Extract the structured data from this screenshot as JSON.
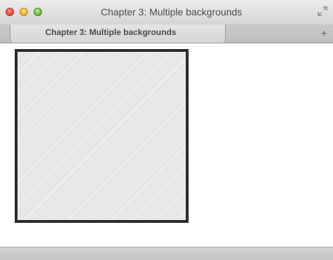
{
  "window": {
    "title": "Chapter 3: Multiple backgrounds",
    "controls": [
      "close-button",
      "minimize-button",
      "zoom-button"
    ],
    "fullscreen_icon": "fullscreen-arrows-icon"
  },
  "tabs": [
    {
      "label": "Chapter 3: Multiple backgrounds",
      "active": true
    }
  ],
  "new_tab_icon": "plus-icon",
  "new_tab_glyph": "+",
  "content": {
    "box_border_color": "#2b2b2b",
    "box_background_color": "#e8e8e8"
  }
}
